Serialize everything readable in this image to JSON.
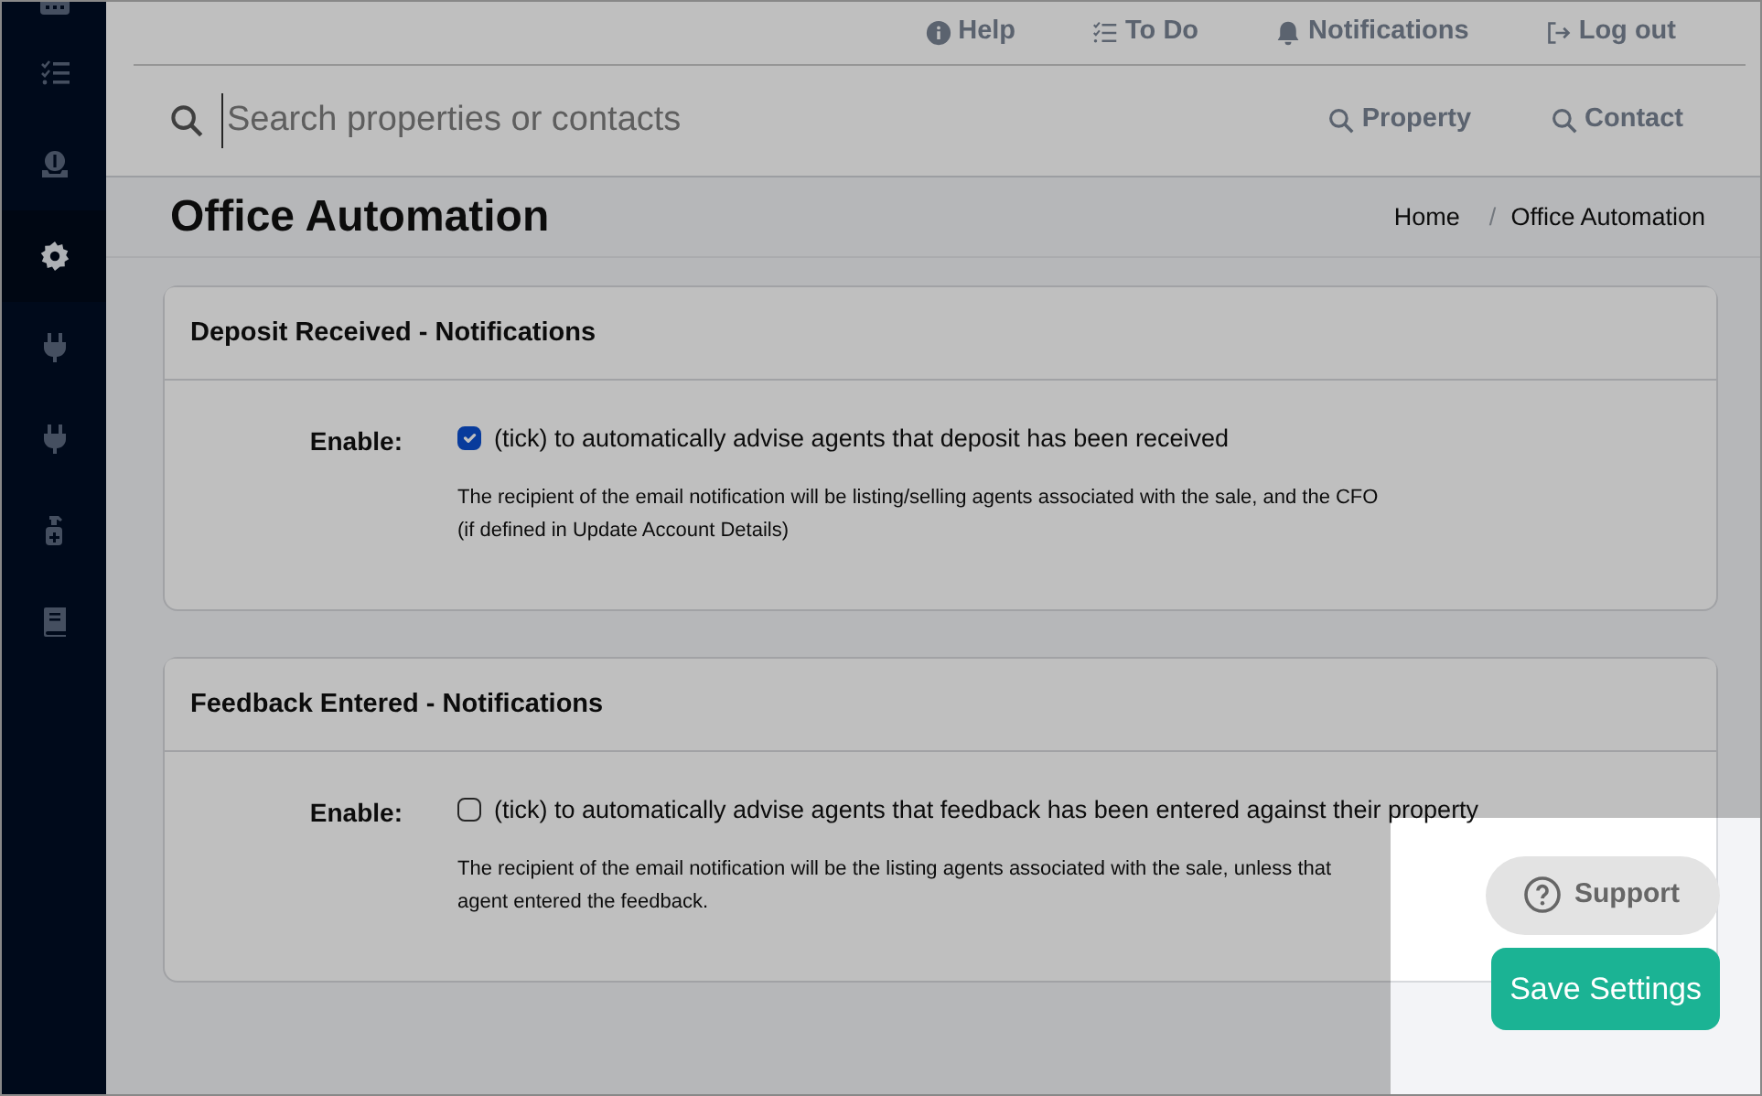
{
  "sidebar": {
    "items": [
      {
        "selected": false
      },
      {
        "selected": false
      },
      {
        "selected": false
      },
      {
        "selected": true
      },
      {
        "selected": false
      },
      {
        "selected": false
      },
      {
        "selected": false
      },
      {
        "selected": false
      }
    ]
  },
  "top_links": [
    {
      "label": "Help"
    },
    {
      "label": "To Do"
    },
    {
      "label": "Notifications"
    },
    {
      "label": "Log out"
    }
  ],
  "search": {
    "placeholder": "Search properties or contacts"
  },
  "search_buttons": [
    {
      "label": "Property"
    },
    {
      "label": "Contact"
    }
  ],
  "page_title": "Office Automation",
  "breadcrumb_separator": "/",
  "breadcrumb": [
    {
      "label": "Home"
    },
    {
      "label": "Office Automation"
    }
  ],
  "cards": [
    {
      "title": "Deposit Received - Notifications",
      "enable_label": "Enable:",
      "checked": true,
      "option": "(tick) to automatically advise agents that deposit has been received",
      "note_lines": [
        "The recipient of the email notification will be listing/selling agents associated with the sale, and the CFO",
        "(if defined in Update Account Details)"
      ]
    },
    {
      "title": "Feedback Entered - Notifications",
      "enable_label": "Enable:",
      "checked": false,
      "option": "(tick) to automatically advise agents that feedback has been entered against their property",
      "note_lines": [
        "The recipient of the email notification will be the listing agents associated with the sale, unless that",
        "agent entered the feedback."
      ]
    }
  ],
  "support_button": "Support",
  "save_button": "Save Settings"
}
